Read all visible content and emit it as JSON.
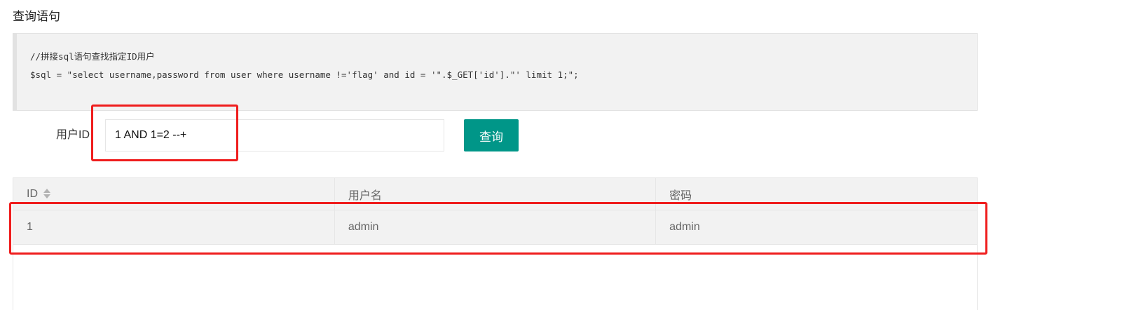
{
  "section": {
    "title": "查询语句"
  },
  "code": {
    "lines": [
      "//拼接sql语句查找指定ID用户",
      "$sql = \"select username,password from user where username !='flag' and id = '\".$_GET['id'].\"' limit 1;\";"
    ]
  },
  "form": {
    "label": "用户ID",
    "input_value": "1 AND 1=2 --+",
    "button_label": "查询"
  },
  "table": {
    "headers": [
      "ID",
      "用户名",
      "密码"
    ],
    "rows": [
      [
        "1",
        "admin",
        "admin"
      ]
    ],
    "sort_icon": "sort-icon"
  },
  "colors": {
    "accent": "#009688",
    "highlight": "#ef1d1d"
  }
}
